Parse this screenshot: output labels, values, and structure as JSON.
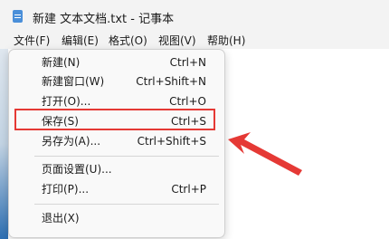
{
  "window": {
    "title": "新建 文本文档.txt - 记事本"
  },
  "menubar": [
    "文件(F)",
    "编辑(E)",
    "格式(O)",
    "视图(V)",
    "帮助(H)"
  ],
  "file_menu": {
    "items": [
      {
        "label": "新建(N)",
        "shortcut": "Ctrl+N"
      },
      {
        "label": "新建窗口(W)",
        "shortcut": "Ctrl+Shift+N"
      },
      {
        "label": "打开(O)...",
        "shortcut": "Ctrl+O"
      },
      {
        "label": "保存(S)",
        "shortcut": "Ctrl+S"
      },
      {
        "label": "另存为(A)...",
        "shortcut": "Ctrl+Shift+S"
      },
      {
        "label": "页面设置(U)...",
        "shortcut": ""
      },
      {
        "label": "打印(P)...",
        "shortcut": "Ctrl+P"
      },
      {
        "label": "退出(X)",
        "shortcut": ""
      }
    ]
  },
  "annotation": {
    "highlighted_item": "保存(S)",
    "highlight_color": "#e53935",
    "arrow_color": "#e53935"
  },
  "colors": {
    "titlebar_bg": "#f3f3f3",
    "menu_bg": "#f9f9f9",
    "app_icon": "#4a8fd9"
  },
  "icons": {
    "app": "notepad-icon",
    "arrow": "red-arrow-icon"
  }
}
